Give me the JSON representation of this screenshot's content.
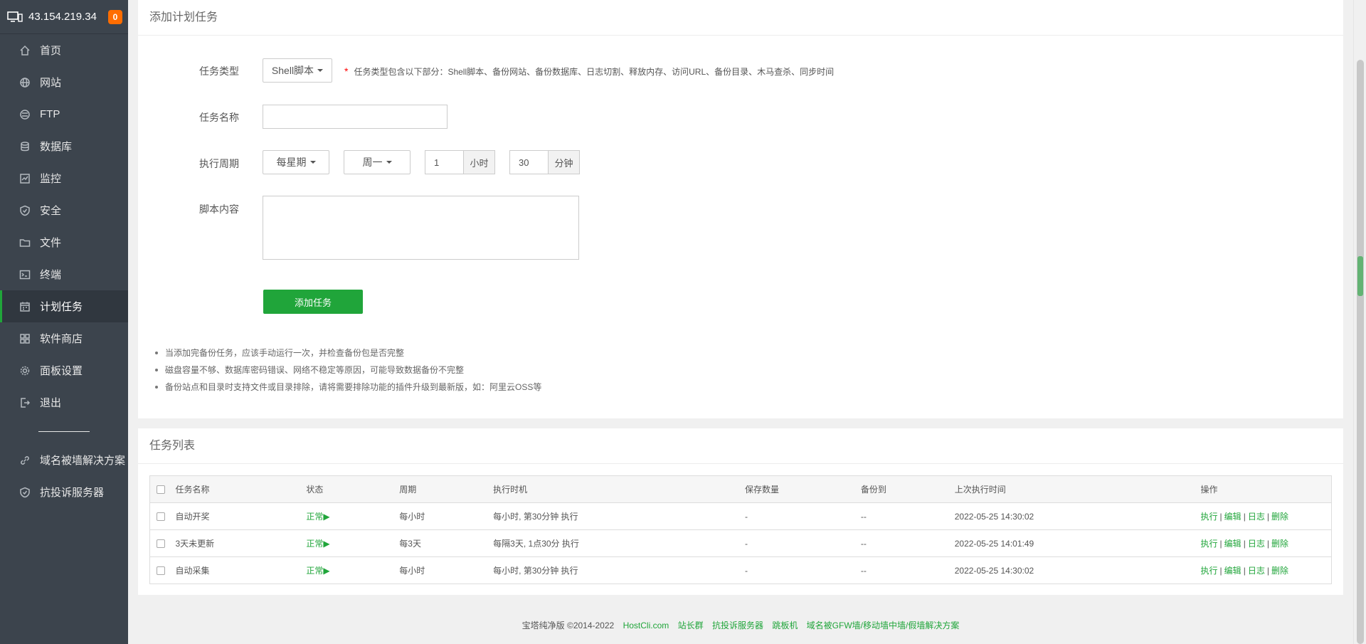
{
  "host": {
    "ip": "43.154.219.34",
    "badge": "0"
  },
  "sidebar": {
    "items": [
      {
        "label": "首页",
        "icon": "home-icon"
      },
      {
        "label": "网站",
        "icon": "globe-icon"
      },
      {
        "label": "FTP",
        "icon": "ftp-icon"
      },
      {
        "label": "数据库",
        "icon": "database-icon"
      },
      {
        "label": "监控",
        "icon": "monitor-icon"
      },
      {
        "label": "安全",
        "icon": "shield-icon"
      },
      {
        "label": "文件",
        "icon": "folder-icon"
      },
      {
        "label": "终端",
        "icon": "terminal-icon"
      },
      {
        "label": "计划任务",
        "icon": "calendar-icon",
        "active": true
      },
      {
        "label": "软件商店",
        "icon": "apps-icon"
      },
      {
        "label": "面板设置",
        "icon": "gear-icon"
      },
      {
        "label": "退出",
        "icon": "logout-icon"
      }
    ],
    "extra": [
      {
        "label": "域名被墙解决方案",
        "icon": "link-icon"
      },
      {
        "label": "抗投诉服务器",
        "icon": "shield-check-icon"
      }
    ]
  },
  "add_panel": {
    "title": "添加计划任务",
    "type_label": "任务类型",
    "type_value": "Shell脚本",
    "type_hint_star": "*",
    "type_hint": "任务类型包含以下部分：Shell脚本、备份网站、备份数据库、日志切割、释放内存、访问URL、备份目录、木马查杀、同步时间",
    "name_label": "任务名称",
    "name_value": "",
    "cycle_label": "执行周期",
    "cycle_value": "每星期",
    "weekday_value": "周一",
    "hour_value": "1",
    "hour_unit": "小时",
    "minute_value": "30",
    "minute_unit": "分钟",
    "script_label": "脚本内容",
    "script_value": "",
    "submit_label": "添加任务",
    "tips": [
      "当添加完备份任务，应该手动运行一次，并检查备份包是否完整",
      "磁盘容量不够、数据库密码错误、网络不稳定等原因，可能导致数据备份不完整",
      "备份站点和目录时支持文件或目录排除，请将需要排除功能的插件升级到最新版，如：阿里云OSS等"
    ]
  },
  "list_panel": {
    "title": "任务列表",
    "columns": [
      "任务名称",
      "状态",
      "周期",
      "执行时机",
      "保存数量",
      "备份到",
      "上次执行时间",
      "操作"
    ],
    "rows": [
      {
        "name": "自动开奖",
        "status": "正常▶",
        "cycle": "每小时",
        "timing": "每小时, 第30分钟 执行",
        "keep": "-",
        "backup_to": "--",
        "last_run": "2022-05-25 14:30:02"
      },
      {
        "name": "3天未更新",
        "status": "正常▶",
        "cycle": "每3天",
        "timing": "每隔3天, 1点30分 执行",
        "keep": "-",
        "backup_to": "--",
        "last_run": "2022-05-25 14:01:49"
      },
      {
        "name": "自动采集",
        "status": "正常▶",
        "cycle": "每小时",
        "timing": "每小时, 第30分钟 执行",
        "keep": "-",
        "backup_to": "--",
        "last_run": "2022-05-25 14:30:02"
      }
    ],
    "ops": [
      "执行",
      "编辑",
      "日志",
      "删除"
    ],
    "op_sep": "|"
  },
  "footer": {
    "copyright": "宝塔纯净版 ©2014-2022",
    "links": [
      "HostCli.com",
      "站长群",
      "抗投诉服务器",
      "跳板机",
      "域名被GFW墙/移动墙中墙/假墙解决方案"
    ]
  },
  "colors": {
    "sidebar_bg": "#3c444d",
    "accent": "#20a53a",
    "badge": "#ff6d00"
  }
}
